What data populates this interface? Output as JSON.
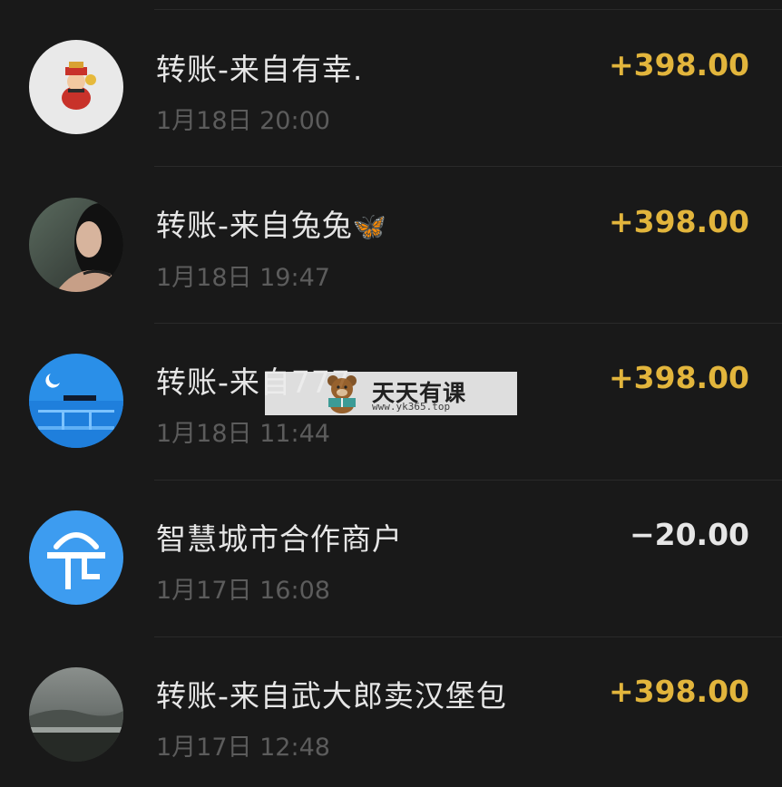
{
  "colors": {
    "income": "#e2b53c",
    "expense": "#e6e6e6",
    "background": "#191919"
  },
  "transactions": [
    {
      "title": "转账-来自有幸.",
      "time": "1月18日 20:00",
      "amount": "+398.00",
      "type": "income",
      "avatar_icon": "caishen-avatar-icon"
    },
    {
      "title": "转账-来自兔兔",
      "title_emoji": "🦋",
      "time": "1月18日 19:47",
      "amount": "+398.00",
      "type": "income",
      "avatar_icon": "woman-portrait-avatar-icon"
    },
    {
      "title": "转账-来自777",
      "time": "1月18日 11:44",
      "amount": "+398.00",
      "type": "income",
      "avatar_icon": "blue-night-avatar-icon"
    },
    {
      "title": "智慧城市合作商户",
      "time": "1月17日 16:08",
      "amount": "−20.00",
      "type": "expense",
      "avatar_icon": "smart-city-logo-icon"
    },
    {
      "title": "转账-来自武大郎卖汉堡包",
      "time": "1月17日 12:48",
      "amount": "+398.00",
      "type": "income",
      "avatar_icon": "landscape-avatar-icon"
    }
  ],
  "watermark": {
    "title": "天天有课",
    "url": "www.yk365.top"
  }
}
